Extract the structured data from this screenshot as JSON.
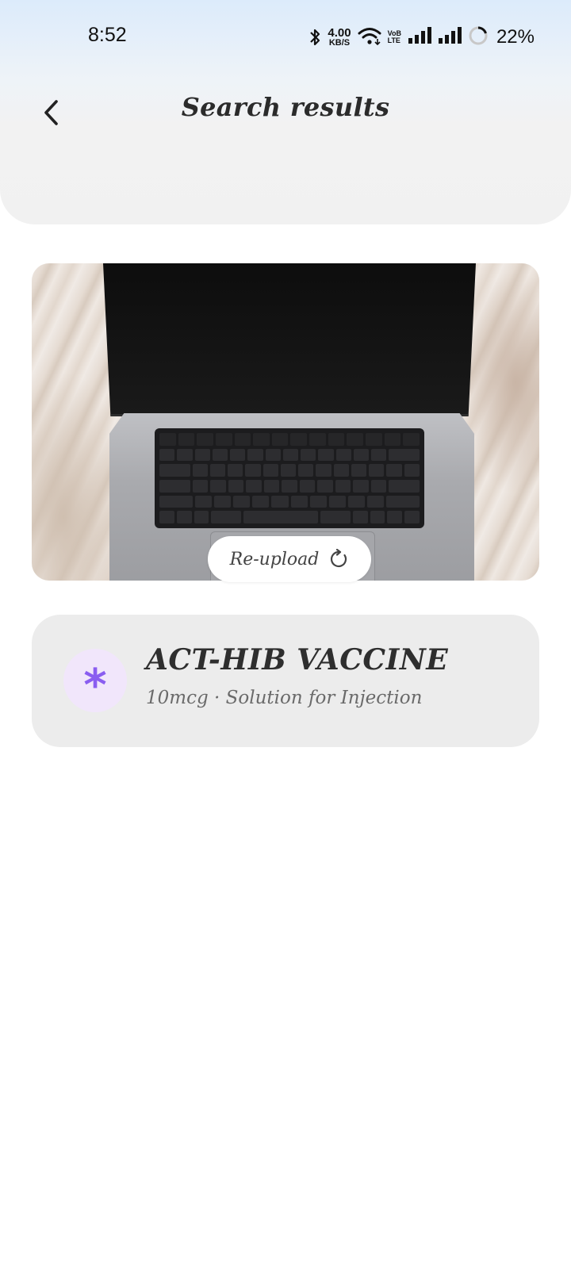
{
  "status_bar": {
    "time": "8:52",
    "net_speed_value": "4.00",
    "net_speed_unit": "KB/S",
    "volte_top": "VoB",
    "volte_bottom": "LTE",
    "battery": "22%"
  },
  "header": {
    "title": "Search results",
    "back_icon": "chevron-left-icon"
  },
  "upload": {
    "reupload_label": "Re-upload",
    "reupload_icon": "refresh-icon"
  },
  "result": {
    "name": "ACT-HIB VACCINE",
    "details": "10mcg · Solution for Injection",
    "icon": "asterisk-icon",
    "icon_color": "#8a5df0",
    "icon_bg": "#f1e6fb"
  }
}
